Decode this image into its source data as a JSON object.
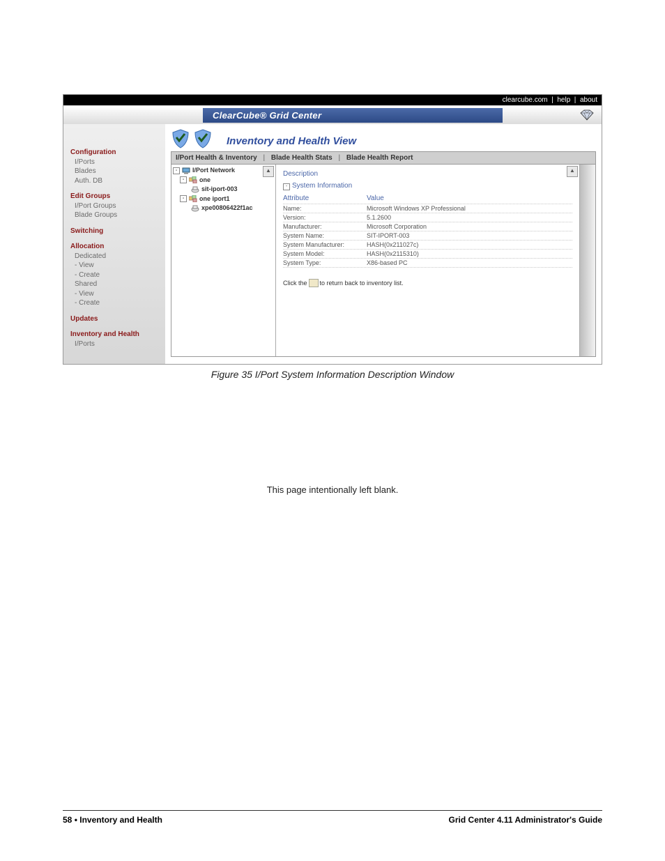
{
  "topbar": {
    "link1": "clearcube.com",
    "link2": "help",
    "link3": "about"
  },
  "brand": {
    "title": "ClearCube® Grid Center"
  },
  "sidebar": {
    "groups": [
      {
        "label": "Configuration",
        "items": [
          "I/Ports",
          "Blades",
          "Auth. DB"
        ]
      },
      {
        "label": "Edit Groups",
        "items": [
          "I/Port Groups",
          "Blade Groups"
        ]
      },
      {
        "label": "Switching",
        "items": []
      },
      {
        "label": "Allocation",
        "items": [
          "Dedicated",
          "- View",
          "- Create",
          "Shared",
          "- View",
          "- Create"
        ]
      },
      {
        "label": "Updates",
        "items": []
      },
      {
        "label": "Inventory and Health",
        "items": [
          "I/Ports"
        ]
      }
    ]
  },
  "view": {
    "title": "Inventory and Health View"
  },
  "tabs": {
    "t1": "I/Port Health & Inventory",
    "t2": "Blade Health Stats",
    "t3": "Blade Health Report"
  },
  "tree": {
    "root": "I/Port Network",
    "n1": "one",
    "n1a": "sit-iport-003",
    "n2": "one iport1",
    "n2a": "xpe00806422f1ac"
  },
  "detail": {
    "title": "Description",
    "subtitle": "System Information",
    "header_attr": "Attribute",
    "header_val": "Value",
    "rows": [
      {
        "attr": "Name:",
        "val": "Microsoft Windows XP Professional"
      },
      {
        "attr": "Version:",
        "val": "5.1.2600"
      },
      {
        "attr": "Manufacturer:",
        "val": "Microsoft Corporation"
      },
      {
        "attr": "System Name:",
        "val": "SIT-IPORT-003"
      },
      {
        "attr": "System Manufacturer:",
        "val": "HASH(0x211027c)"
      },
      {
        "attr": "System Model:",
        "val": "HASH(0x2115310)"
      },
      {
        "attr": "System Type:",
        "val": "X86-based PC"
      }
    ],
    "instr_pre": "Click the",
    "instr_post": "to return back to inventory list."
  },
  "caption": "Figure 35  I/Port System Information Description Window",
  "blank": "This page intentionally left blank.",
  "footer": {
    "left_page": "58",
    "left_sep": " • ",
    "left_text": "Inventory and Health",
    "right": "Grid Center 4.11 Administrator's Guide"
  }
}
